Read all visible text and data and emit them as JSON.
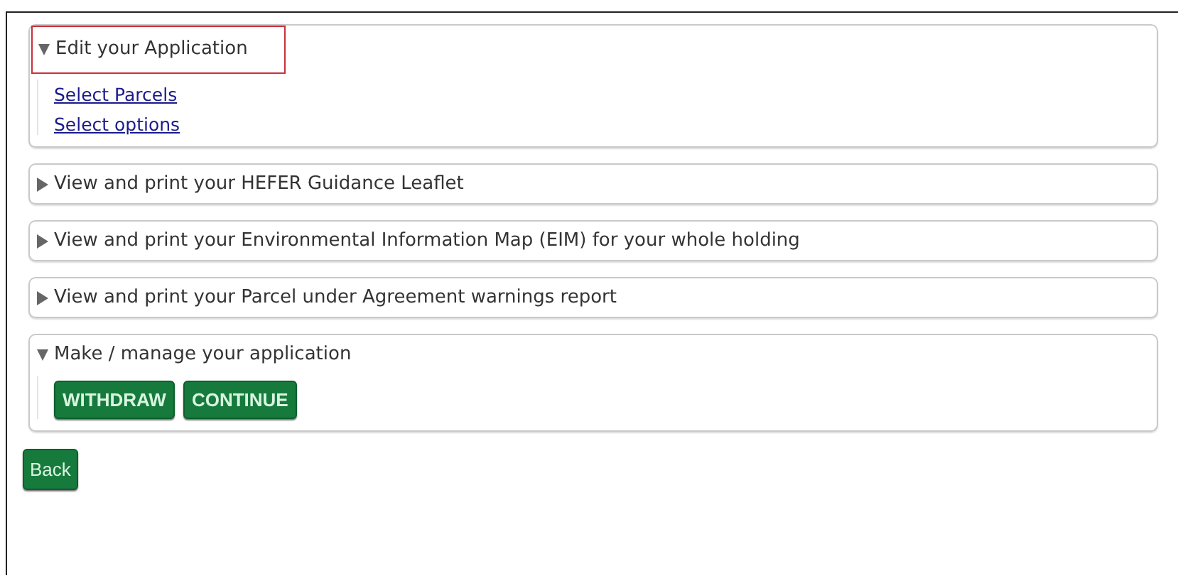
{
  "sections": [
    {
      "title": "Edit your Application",
      "expanded": true,
      "highlighted": true,
      "kind": "links",
      "links": [
        "Select Parcels",
        "Select options"
      ]
    },
    {
      "title": "View and print your HEFER Guidance Leaflet",
      "expanded": false,
      "highlighted": false
    },
    {
      "title": "View and print your Environmental Information Map (EIM) for your whole holding",
      "expanded": false,
      "highlighted": false
    },
    {
      "title": "View and print your Parcel under Agreement warnings report",
      "expanded": false,
      "highlighted": false
    },
    {
      "title": "Make / manage your application",
      "expanded": true,
      "highlighted": false,
      "kind": "buttons",
      "buttons": [
        "WITHDRAW",
        "CONTINUE"
      ]
    }
  ],
  "back_button": "Back"
}
